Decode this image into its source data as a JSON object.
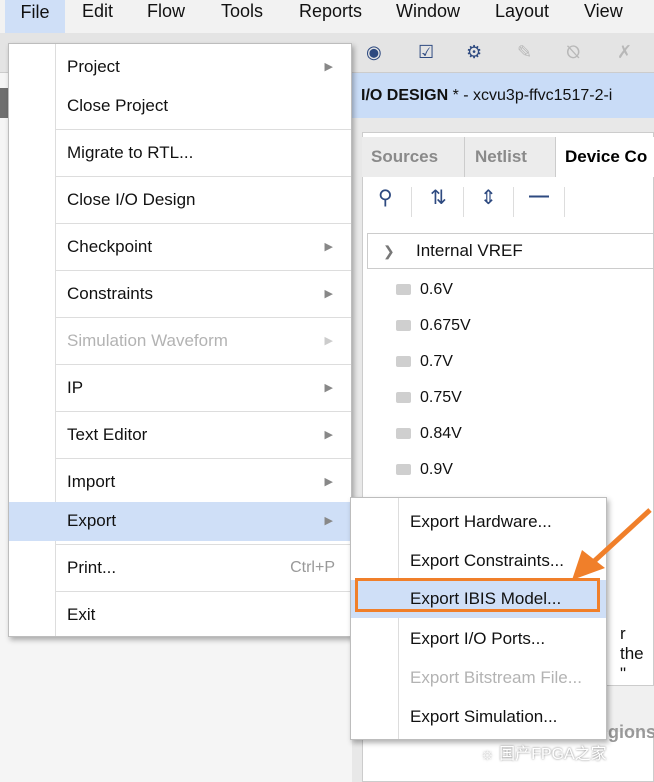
{
  "menubar": {
    "items": [
      "File",
      "Edit",
      "Flow",
      "Tools",
      "Reports",
      "Window",
      "Layout",
      "View"
    ]
  },
  "title": {
    "bold": "I/O DESIGN",
    "rest": " * - xcvu3p-ffvc1517-2-i"
  },
  "tabs": [
    "Sources",
    "Netlist",
    "Device Co"
  ],
  "tree": {
    "header": "Internal VREF",
    "items": [
      "0.6V",
      "0.675V",
      "0.7V",
      "0.75V",
      "0.84V",
      "0.9V"
    ]
  },
  "behind": {
    "text1": "r the \"",
    "text2": "gions"
  },
  "file_menu": [
    {
      "label": "Project",
      "submenu": true
    },
    {
      "label": "Close Project"
    },
    {
      "label": "Migrate to RTL..."
    },
    {
      "label": "Close I/O Design"
    },
    {
      "label": "Checkpoint",
      "submenu": true
    },
    {
      "label": "Constraints",
      "submenu": true
    },
    {
      "label": "Simulation Waveform",
      "submenu": true,
      "disabled": true
    },
    {
      "label": "IP",
      "submenu": true
    },
    {
      "label": "Text Editor",
      "submenu": true
    },
    {
      "label": "Import",
      "submenu": true
    },
    {
      "label": "Export",
      "submenu": true,
      "highlighted": true
    },
    {
      "label": "Print...",
      "shortcut": "Ctrl+P"
    },
    {
      "label": "Exit"
    }
  ],
  "export_menu": [
    {
      "label": "Export Hardware..."
    },
    {
      "label": "Export Constraints..."
    },
    {
      "label": "Export IBIS Model...",
      "highlighted": true
    },
    {
      "label": "Export I/O Ports..."
    },
    {
      "label": "Export Bitstream File...",
      "disabled": true
    },
    {
      "label": "Export Simulation..."
    }
  ],
  "annotation_color": "#f07f2a",
  "highlight_color": "#cfdff7",
  "watermark": "国产FPGA之家"
}
